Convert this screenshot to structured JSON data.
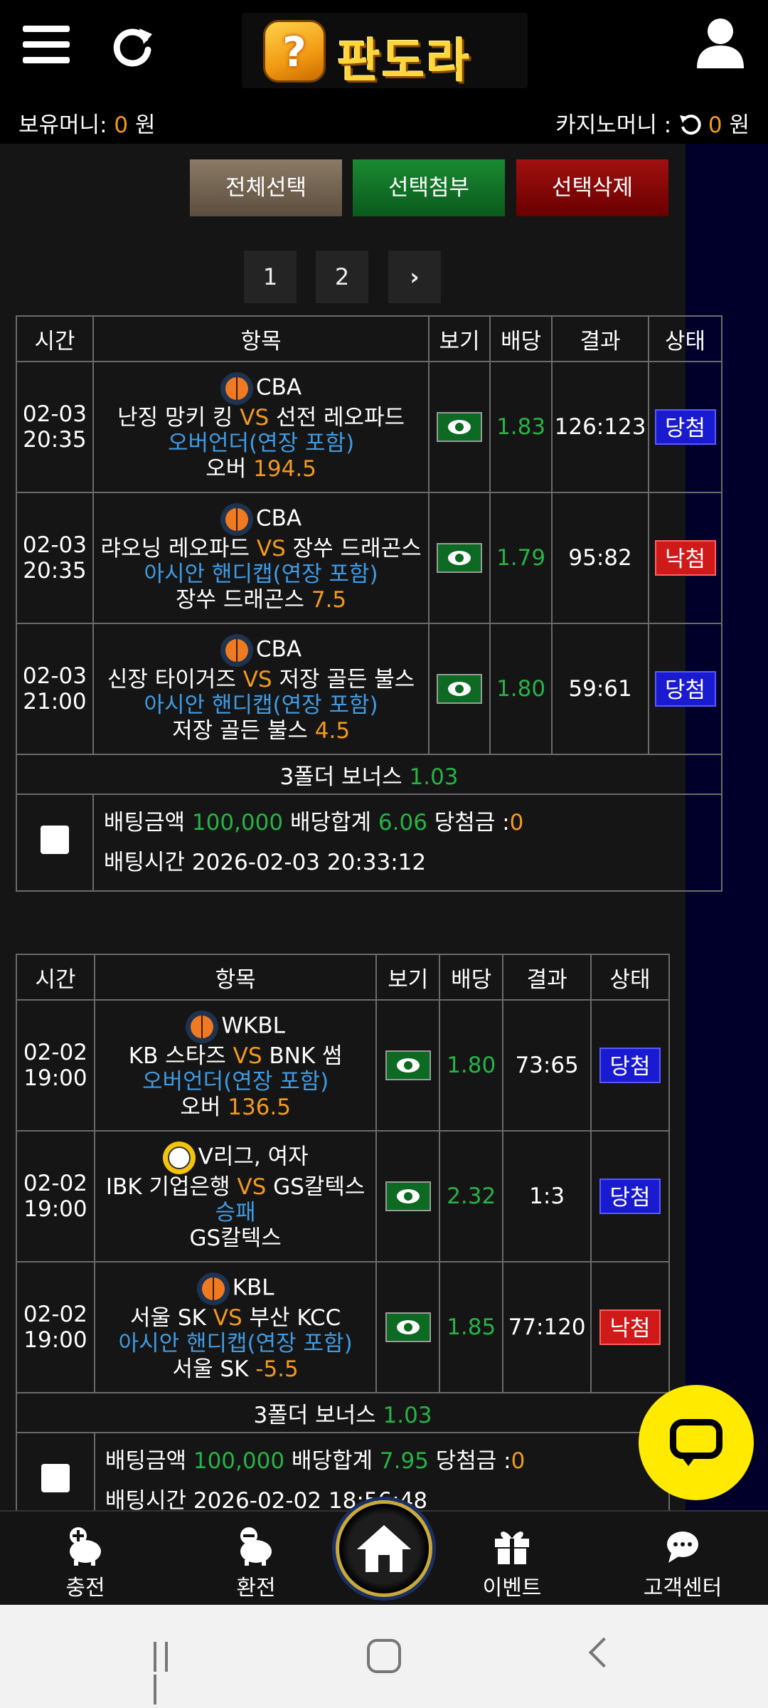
{
  "header": {
    "logo_text": "판도라",
    "logo_badge": "?",
    "balance_label": "보유머니:",
    "balance_value": "0",
    "balance_unit": "원",
    "casino_label": "카지노머니 :",
    "casino_value": "0",
    "casino_unit": "원"
  },
  "actions": {
    "select_all": "전체선택",
    "attach_selected": "선택첨부",
    "delete_selected": "선택삭제"
  },
  "pagination": {
    "pages": [
      "1",
      "2"
    ],
    "next": "›"
  },
  "columns": [
    "시간",
    "항목",
    "보기",
    "배당",
    "결과",
    "상태"
  ],
  "slips": [
    {
      "rows": [
        {
          "date": "02-03",
          "time": "20:35",
          "league": "CBA",
          "home": "난징 망키 킹",
          "vs": "VS",
          "away": "선전 레오파드",
          "market": "오버언더(연장 포함)",
          "pick": "오버",
          "line": "194.5",
          "odds": "1.83",
          "score": "126:123",
          "status": "당첨"
        },
        {
          "date": "02-03",
          "time": "20:35",
          "league": "CBA",
          "home": "랴오닝 레오파드",
          "vs": "VS",
          "away": "장쑤 드래곤스",
          "market": "아시안 핸디캡(연장 포함)",
          "pick": "장쑤 드래곤스",
          "line": "7.5",
          "odds": "1.79",
          "score": "95:82",
          "status": "낙첨"
        },
        {
          "date": "02-03",
          "time": "21:00",
          "league": "CBA",
          "home": "신장 타이거즈",
          "vs": "VS",
          "away": "저장 골든 불스",
          "market": "아시안 핸디캡(연장 포함)",
          "pick": "저장 골든 불스",
          "line": "4.5",
          "odds": "1.80",
          "score": "59:61",
          "status": "당첨"
        }
      ],
      "bonus_label": "3폴더 보너스",
      "bonus_value": "1.03",
      "bet_amount_label": "배팅금액",
      "bet_amount": "100,000",
      "odds_total_label": "배당합계",
      "odds_total": "6.06",
      "win_label": "당첨금 :",
      "win_amount": "0",
      "bet_time_label": "배팅시간",
      "bet_time": "2026-02-03 20:33:12"
    },
    {
      "rows": [
        {
          "date": "02-02",
          "time": "19:00",
          "league": "WKBL",
          "home": "KB 스타즈",
          "vs": "VS",
          "away": "BNK 썸",
          "market": "오버언더(연장 포함)",
          "pick": "오버",
          "line": "136.5",
          "odds": "1.80",
          "score": "73:65",
          "status": "당첨"
        },
        {
          "date": "02-02",
          "time": "19:00",
          "league": "V리그, 여자",
          "home": "IBK 기업은행",
          "vs": "VS",
          "away": "GS칼텍스",
          "market": "승패",
          "pick": "GS칼텍스",
          "line": "",
          "odds": "2.32",
          "score": "1:3",
          "status": "당첨"
        },
        {
          "date": "02-02",
          "time": "19:00",
          "league": "KBL",
          "home": "서울 SK",
          "vs": "VS",
          "away": "부산 KCC",
          "market": "아시안 핸디캡(연장 포함)",
          "pick": "서울 SK",
          "line": "-5.5",
          "odds": "1.85",
          "score": "77:120",
          "status": "낙첨"
        }
      ],
      "bonus_label": "3폴더 보너스",
      "bonus_value": "1.03",
      "bet_amount_label": "배팅금액",
      "bet_amount": "100,000",
      "odds_total_label": "배당합계",
      "odds_total": "7.95",
      "win_label": "당첨금 :",
      "win_amount": "0",
      "bet_time_label": "배팅시간",
      "bet_time": "2026-02-02 18:56:48"
    }
  ],
  "bottom_nav": {
    "charge": "충전",
    "exchange": "환전",
    "event": "이벤트",
    "support": "고객센터"
  },
  "colors": {
    "accent_orange": "#f39a1c",
    "odds_green": "#26b347",
    "market_blue": "#3f9be3",
    "win_blue": "#1a1ad0",
    "lose_red": "#d01a1a",
    "chat_yellow": "#ffea00"
  }
}
